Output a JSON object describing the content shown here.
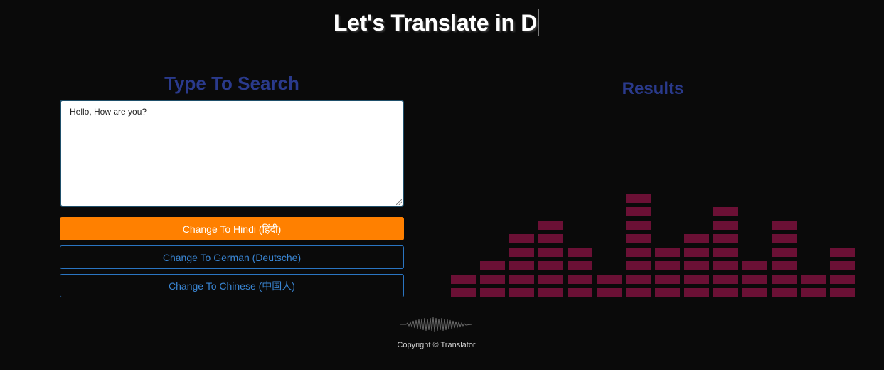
{
  "header": {
    "title": "Let's Translate in D"
  },
  "input_panel": {
    "heading": "Type To Search",
    "textarea_value": "Hello, How are you?"
  },
  "buttons": {
    "hindi": "Change To Hindi (हिंदी)",
    "german": "Change To German (Deutsche)",
    "chinese": "Change To Chinese (中国人)"
  },
  "results_panel": {
    "heading": "Results",
    "equalizer_column_levels": [
      2,
      3,
      5,
      6,
      4,
      2,
      8,
      4,
      5,
      7,
      3,
      6,
      2,
      4
    ]
  },
  "footer": {
    "copyright": "Copyright © Translator"
  },
  "colors": {
    "accent_orange": "#ff8000",
    "heading_blue": "#2a3a8c",
    "button_outline_blue": "#2a75c2",
    "equalizer_bar": "#6b1035",
    "background": "#0a0a0a"
  }
}
